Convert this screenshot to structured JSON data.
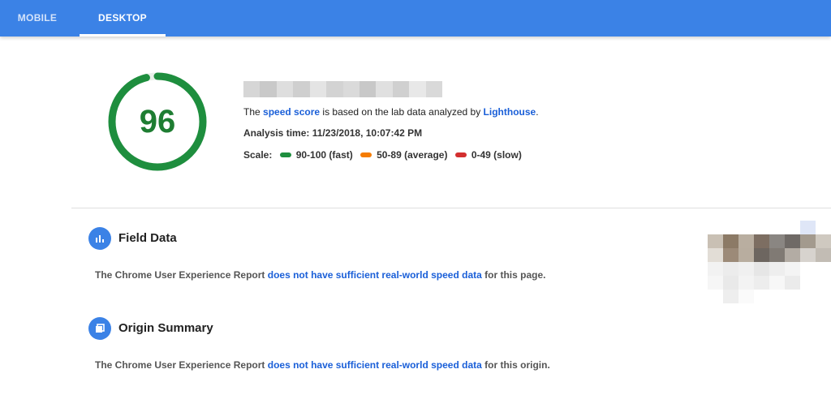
{
  "tabs": [
    {
      "label": "MOBILE",
      "active": false
    },
    {
      "label": "DESKTOP",
      "active": true
    }
  ],
  "score": {
    "value": 96,
    "fraction": 0.96,
    "color": "#1e8e3e"
  },
  "summary": {
    "line1_pre": "The ",
    "line1_link1": "speed score",
    "line1_mid": " is based on the lab data analyzed by ",
    "line1_link2": "Lighthouse",
    "line1_post": ".",
    "analysis_time": "Analysis time: 11/23/2018, 10:07:42 PM",
    "scale_label": "Scale:",
    "scale": [
      {
        "label": "90-100 (fast)",
        "color": "#1e8e3e"
      },
      {
        "label": "50-89 (average)",
        "color": "#f57c00"
      },
      {
        "label": "0-49 (slow)",
        "color": "#d32f2f"
      }
    ]
  },
  "field_data": {
    "title": "Field Data",
    "icon": "bar-chart-icon",
    "text_pre": "The Chrome User Experience Report ",
    "text_link": "does not have sufficient real-world speed data",
    "text_post": " for this page."
  },
  "origin_summary": {
    "title": "Origin Summary",
    "icon": "copy-icon",
    "text_pre": "The Chrome User Experience Report ",
    "text_link": "does not have sufficient real-world speed data",
    "text_post": " for this origin."
  },
  "colors": {
    "accent": "#3b82e6",
    "link": "#1a5fd8",
    "good": "#1e8e3e"
  }
}
